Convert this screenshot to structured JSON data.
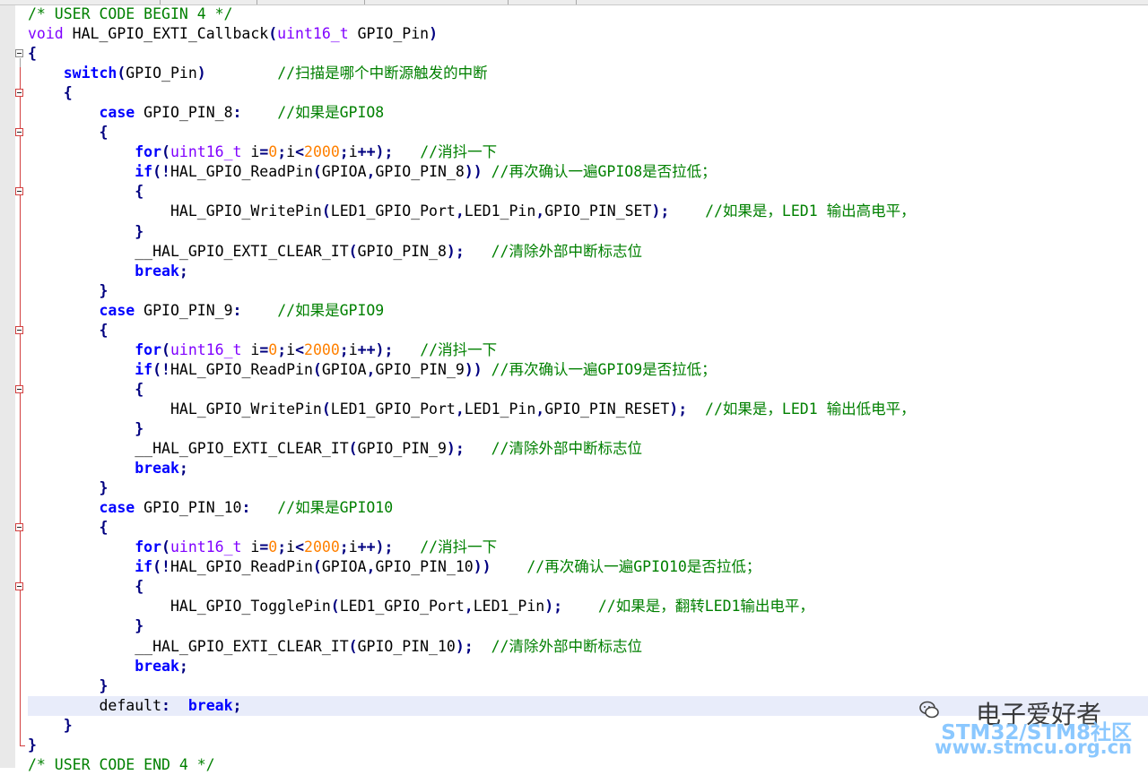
{
  "editor": {
    "code_lines": [
      [
        {
          "t": "/* USER CODE BEGIN 4 */",
          "c": "cm"
        }
      ],
      [
        {
          "t": "void",
          "c": "ty"
        },
        {
          "t": " HAL_GPIO_EXTI_Callback"
        },
        {
          "t": "(",
          "c": "op"
        },
        {
          "t": "uint16_t",
          "c": "ty"
        },
        {
          "t": " GPIO_Pin"
        },
        {
          "t": ")",
          "c": "op"
        }
      ],
      [
        {
          "t": "{",
          "c": "op"
        }
      ],
      [
        {
          "t": "    "
        },
        {
          "t": "switch",
          "c": "kw"
        },
        {
          "t": "(",
          "c": "op"
        },
        {
          "t": "GPIO_Pin"
        },
        {
          "t": ")",
          "c": "op"
        },
        {
          "t": "        "
        },
        {
          "t": "//扫描是哪个中断源触发的中断",
          "c": "cm"
        }
      ],
      [
        {
          "t": "    "
        },
        {
          "t": "{",
          "c": "op"
        }
      ],
      [
        {
          "t": "        "
        },
        {
          "t": "case",
          "c": "kw"
        },
        {
          "t": " GPIO_PIN_8"
        },
        {
          "t": ":",
          "c": "op"
        },
        {
          "t": "    "
        },
        {
          "t": "//如果是GPIO8",
          "c": "cm"
        }
      ],
      [
        {
          "t": "        "
        },
        {
          "t": "{",
          "c": "op"
        }
      ],
      [
        {
          "t": "            "
        },
        {
          "t": "for",
          "c": "kw"
        },
        {
          "t": "(",
          "c": "op"
        },
        {
          "t": "uint16_t",
          "c": "ty"
        },
        {
          "t": " i"
        },
        {
          "t": "=",
          "c": "op"
        },
        {
          "t": "0",
          "c": "num"
        },
        {
          "t": ";",
          "c": "op"
        },
        {
          "t": "i"
        },
        {
          "t": "<",
          "c": "op"
        },
        {
          "t": "2000",
          "c": "num"
        },
        {
          "t": ";",
          "c": "op"
        },
        {
          "t": "i"
        },
        {
          "t": "++);",
          "c": "op"
        },
        {
          "t": "   "
        },
        {
          "t": "//消抖一下",
          "c": "cm"
        }
      ],
      [
        {
          "t": "            "
        },
        {
          "t": "if",
          "c": "kw"
        },
        {
          "t": "(!",
          "c": "op"
        },
        {
          "t": "HAL_GPIO_ReadPin"
        },
        {
          "t": "(",
          "c": "op"
        },
        {
          "t": "GPIOA"
        },
        {
          "t": ",",
          "c": "op"
        },
        {
          "t": "GPIO_PIN_8"
        },
        {
          "t": "))",
          "c": "op"
        },
        {
          "t": " "
        },
        {
          "t": "//再次确认一遍GPIO8是否拉低；",
          "c": "cm"
        }
      ],
      [
        {
          "t": "            "
        },
        {
          "t": "{",
          "c": "op"
        }
      ],
      [
        {
          "t": "                "
        },
        {
          "t": "HAL_GPIO_WritePin"
        },
        {
          "t": "(",
          "c": "op"
        },
        {
          "t": "LED1_GPIO_Port"
        },
        {
          "t": ",",
          "c": "op"
        },
        {
          "t": "LED1_Pin"
        },
        {
          "t": ",",
          "c": "op"
        },
        {
          "t": "GPIO_PIN_SET"
        },
        {
          "t": ");",
          "c": "op"
        },
        {
          "t": "    "
        },
        {
          "t": "//如果是，LED1 输出高电平，",
          "c": "cm"
        }
      ],
      [
        {
          "t": "            "
        },
        {
          "t": "}",
          "c": "op"
        }
      ],
      [
        {
          "t": "            "
        },
        {
          "t": "__HAL_GPIO_EXTI_CLEAR_IT"
        },
        {
          "t": "(",
          "c": "op"
        },
        {
          "t": "GPIO_PIN_8"
        },
        {
          "t": ");",
          "c": "op"
        },
        {
          "t": "   "
        },
        {
          "t": "//清除外部中断标志位",
          "c": "cm"
        }
      ],
      [
        {
          "t": "            "
        },
        {
          "t": "break",
          "c": "kw"
        },
        {
          "t": ";",
          "c": "op"
        }
      ],
      [
        {
          "t": "        "
        },
        {
          "t": "}",
          "c": "op"
        }
      ],
      [
        {
          "t": "        "
        },
        {
          "t": "case",
          "c": "kw"
        },
        {
          "t": " GPIO_PIN_9"
        },
        {
          "t": ":",
          "c": "op"
        },
        {
          "t": "    "
        },
        {
          "t": "//如果是GPIO9",
          "c": "cm"
        }
      ],
      [
        {
          "t": "        "
        },
        {
          "t": "{",
          "c": "op"
        }
      ],
      [
        {
          "t": "            "
        },
        {
          "t": "for",
          "c": "kw"
        },
        {
          "t": "(",
          "c": "op"
        },
        {
          "t": "uint16_t",
          "c": "ty"
        },
        {
          "t": " i"
        },
        {
          "t": "=",
          "c": "op"
        },
        {
          "t": "0",
          "c": "num"
        },
        {
          "t": ";",
          "c": "op"
        },
        {
          "t": "i"
        },
        {
          "t": "<",
          "c": "op"
        },
        {
          "t": "2000",
          "c": "num"
        },
        {
          "t": ";",
          "c": "op"
        },
        {
          "t": "i"
        },
        {
          "t": "++);",
          "c": "op"
        },
        {
          "t": "   "
        },
        {
          "t": "//消抖一下",
          "c": "cm"
        }
      ],
      [
        {
          "t": "            "
        },
        {
          "t": "if",
          "c": "kw"
        },
        {
          "t": "(!",
          "c": "op"
        },
        {
          "t": "HAL_GPIO_ReadPin"
        },
        {
          "t": "(",
          "c": "op"
        },
        {
          "t": "GPIOA"
        },
        {
          "t": ",",
          "c": "op"
        },
        {
          "t": "GPIO_PIN_9"
        },
        {
          "t": "))",
          "c": "op"
        },
        {
          "t": " "
        },
        {
          "t": "//再次确认一遍GPIO9是否拉低；",
          "c": "cm"
        }
      ],
      [
        {
          "t": "            "
        },
        {
          "t": "{",
          "c": "op"
        }
      ],
      [
        {
          "t": "                "
        },
        {
          "t": "HAL_GPIO_WritePin"
        },
        {
          "t": "(",
          "c": "op"
        },
        {
          "t": "LED1_GPIO_Port"
        },
        {
          "t": ",",
          "c": "op"
        },
        {
          "t": "LED1_Pin"
        },
        {
          "t": ",",
          "c": "op"
        },
        {
          "t": "GPIO_PIN_RESET"
        },
        {
          "t": ");",
          "c": "op"
        },
        {
          "t": "  "
        },
        {
          "t": "//如果是，LED1 输出低电平，",
          "c": "cm"
        }
      ],
      [
        {
          "t": "            "
        },
        {
          "t": "}",
          "c": "op"
        }
      ],
      [
        {
          "t": "            "
        },
        {
          "t": "__HAL_GPIO_EXTI_CLEAR_IT"
        },
        {
          "t": "(",
          "c": "op"
        },
        {
          "t": "GPIO_PIN_9"
        },
        {
          "t": ");",
          "c": "op"
        },
        {
          "t": "   "
        },
        {
          "t": "//清除外部中断标志位",
          "c": "cm"
        }
      ],
      [
        {
          "t": "            "
        },
        {
          "t": "break",
          "c": "kw"
        },
        {
          "t": ";",
          "c": "op"
        }
      ],
      [
        {
          "t": "        "
        },
        {
          "t": "}",
          "c": "op"
        }
      ],
      [
        {
          "t": "        "
        },
        {
          "t": "case",
          "c": "kw"
        },
        {
          "t": " GPIO_PIN_10"
        },
        {
          "t": ":",
          "c": "op"
        },
        {
          "t": "   "
        },
        {
          "t": "//如果是GPIO10",
          "c": "cm"
        }
      ],
      [
        {
          "t": "        "
        },
        {
          "t": "{",
          "c": "op"
        }
      ],
      [
        {
          "t": "            "
        },
        {
          "t": "for",
          "c": "kw"
        },
        {
          "t": "(",
          "c": "op"
        },
        {
          "t": "uint16_t",
          "c": "ty"
        },
        {
          "t": " i"
        },
        {
          "t": "=",
          "c": "op"
        },
        {
          "t": "0",
          "c": "num"
        },
        {
          "t": ";",
          "c": "op"
        },
        {
          "t": "i"
        },
        {
          "t": "<",
          "c": "op"
        },
        {
          "t": "2000",
          "c": "num"
        },
        {
          "t": ";",
          "c": "op"
        },
        {
          "t": "i"
        },
        {
          "t": "++);",
          "c": "op"
        },
        {
          "t": "   "
        },
        {
          "t": "//消抖一下",
          "c": "cm"
        }
      ],
      [
        {
          "t": "            "
        },
        {
          "t": "if",
          "c": "kw"
        },
        {
          "t": "(!",
          "c": "op"
        },
        {
          "t": "HAL_GPIO_ReadPin"
        },
        {
          "t": "(",
          "c": "op"
        },
        {
          "t": "GPIOA"
        },
        {
          "t": ",",
          "c": "op"
        },
        {
          "t": "GPIO_PIN_10"
        },
        {
          "t": "))",
          "c": "op"
        },
        {
          "t": "    "
        },
        {
          "t": "//再次确认一遍GPIO10是否拉低；",
          "c": "cm"
        }
      ],
      [
        {
          "t": "            "
        },
        {
          "t": "{",
          "c": "op"
        }
      ],
      [
        {
          "t": "                "
        },
        {
          "t": "HAL_GPIO_TogglePin"
        },
        {
          "t": "(",
          "c": "op"
        },
        {
          "t": "LED1_GPIO_Port"
        },
        {
          "t": ",",
          "c": "op"
        },
        {
          "t": "LED1_Pin"
        },
        {
          "t": ");",
          "c": "op"
        },
        {
          "t": "    "
        },
        {
          "t": "//如果是，翻转LED1输出电平，",
          "c": "cm"
        }
      ],
      [
        {
          "t": "            "
        },
        {
          "t": "}",
          "c": "op"
        }
      ],
      [
        {
          "t": "            "
        },
        {
          "t": "__HAL_GPIO_EXTI_CLEAR_IT"
        },
        {
          "t": "(",
          "c": "op"
        },
        {
          "t": "GPIO_PIN_10"
        },
        {
          "t": ");",
          "c": "op"
        },
        {
          "t": "  "
        },
        {
          "t": "//清除外部中断标志位",
          "c": "cm"
        }
      ],
      [
        {
          "t": "            "
        },
        {
          "t": "break",
          "c": "kw"
        },
        {
          "t": ";",
          "c": "op"
        }
      ],
      [
        {
          "t": "        "
        },
        {
          "t": "}",
          "c": "op"
        }
      ],
      [
        {
          "t": "        "
        },
        {
          "t": "default"
        },
        {
          "t": ":",
          "c": "op"
        },
        {
          "t": "  "
        },
        {
          "t": "break",
          "c": "kw"
        },
        {
          "t": ";",
          "c": "op"
        }
      ],
      [
        {
          "t": "    "
        },
        {
          "t": "}",
          "c": "op"
        }
      ],
      [
        {
          "t": "}",
          "c": "op"
        }
      ],
      [
        {
          "t": "/* USER CODE END 4 */",
          "c": "cm"
        }
      ]
    ],
    "current_line_index": 35,
    "fold_markers": [
      {
        "line": 2,
        "style": "box"
      },
      {
        "line": 4,
        "style": "box-red"
      },
      {
        "line": 6,
        "style": "box-red"
      },
      {
        "line": 9,
        "style": "box-red"
      },
      {
        "line": 16,
        "style": "box-red"
      },
      {
        "line": 19,
        "style": "box-red"
      },
      {
        "line": 26,
        "style": "box-red"
      },
      {
        "line": 29,
        "style": "box-red"
      }
    ],
    "colors": {
      "keyword": "#0000ff",
      "type": "#8000ff",
      "number": "#ff8000",
      "comment": "#008000",
      "operator": "#000080",
      "current_line": "#e8ecfa"
    }
  },
  "watermark": {
    "line1": "电子爱好者",
    "line2": "STM32/STM8社区",
    "line3": "www.stmcu.org.cn"
  }
}
